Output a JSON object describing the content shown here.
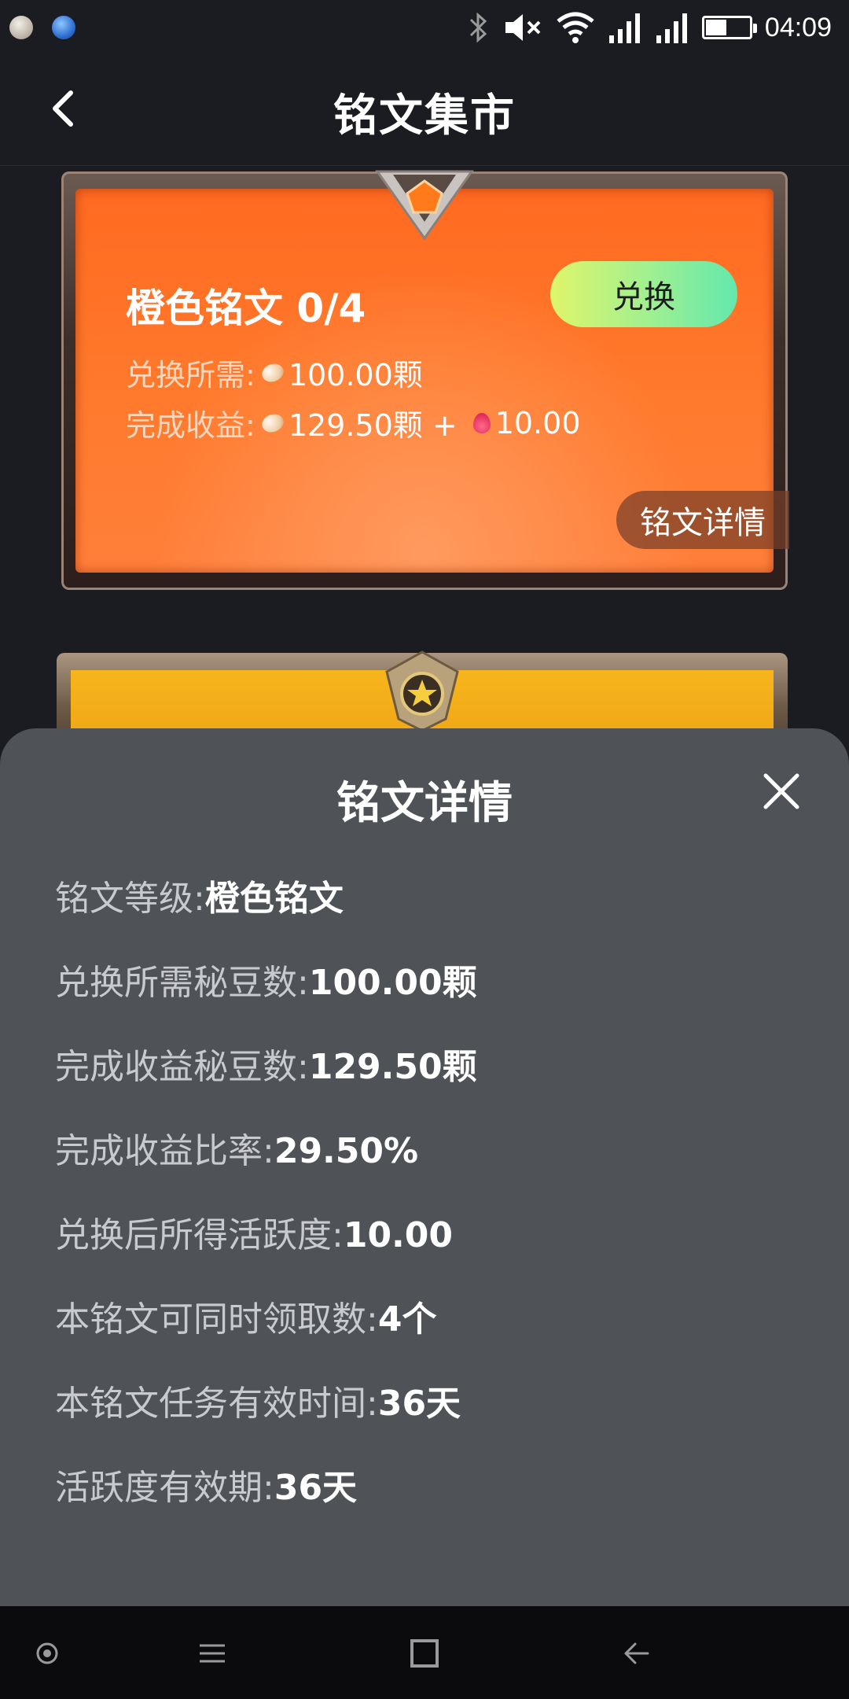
{
  "status_bar": {
    "time": "04:09"
  },
  "header": {
    "title": "铭文集市"
  },
  "card": {
    "title": "橙色铭文 0/4",
    "exchange_button": "兑换",
    "cost_label": "兑换所需:",
    "cost_value": "100.00颗",
    "reward_label": "完成收益:",
    "reward_value": "129.50颗 +",
    "reward_activity": "10.00",
    "detail_tab": "铭文详情"
  },
  "sheet": {
    "title": "铭文详情",
    "rows": [
      {
        "label": "铭文等级:",
        "value": "橙色铭文"
      },
      {
        "label": "兑换所需秘豆数:",
        "value": "100.00颗"
      },
      {
        "label": "完成收益秘豆数:",
        "value": "129.50颗"
      },
      {
        "label": "完成收益比率:",
        "value": "29.50%"
      },
      {
        "label": "兑换后所得活跃度:",
        "value": "10.00"
      },
      {
        "label": "本铭文可同时领取数:",
        "value": "4个"
      },
      {
        "label": "本铭文任务有效时间:",
        "value": "36天"
      },
      {
        "label": "活跃度有效期:",
        "value": "36天"
      }
    ]
  },
  "colors": {
    "orange_card": "#ff7a2c",
    "gold_card": "#f7b51c",
    "sheet_bg": "#4f5257",
    "button_gradient_start": "#dff56a",
    "button_gradient_end": "#63e8ad"
  }
}
